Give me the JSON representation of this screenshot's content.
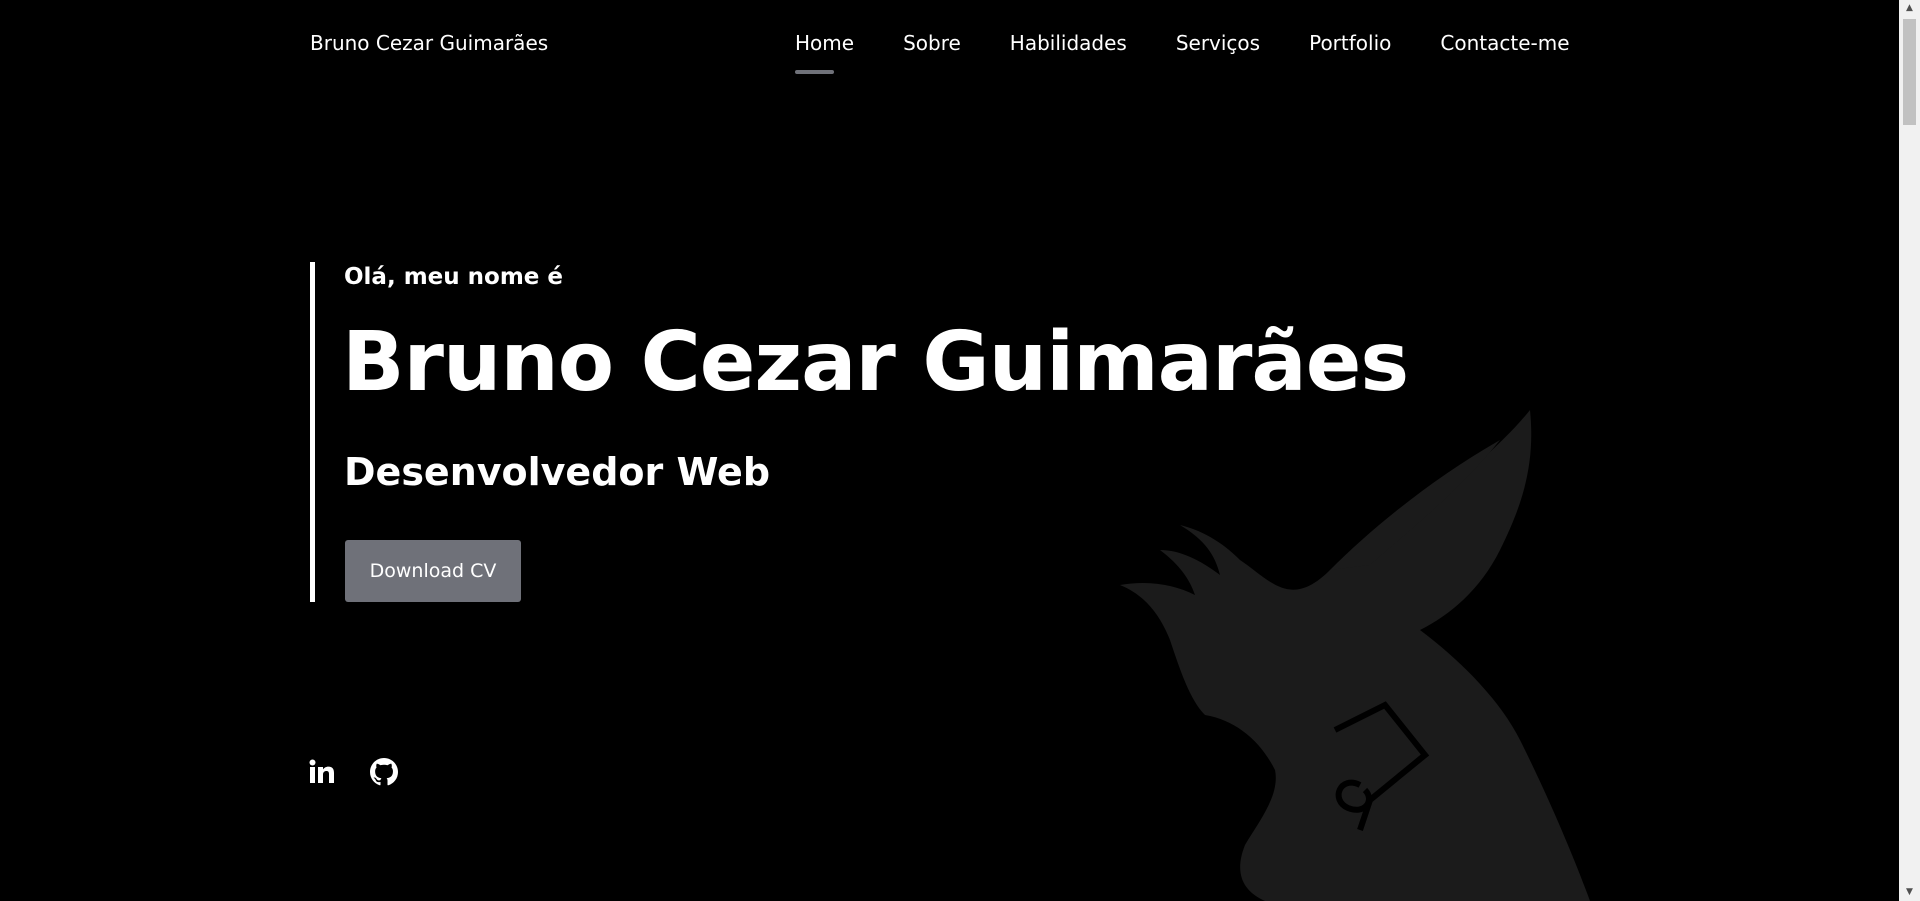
{
  "header": {
    "brand": "Bruno Cezar Guimarães",
    "nav": [
      {
        "label": "Home",
        "active": true
      },
      {
        "label": "Sobre",
        "active": false
      },
      {
        "label": "Habilidades",
        "active": false
      },
      {
        "label": "Serviços",
        "active": false
      },
      {
        "label": "Portfolio",
        "active": false
      },
      {
        "label": "Contacte-me",
        "active": false
      }
    ]
  },
  "hero": {
    "greeting": "Olá, meu nome é",
    "name": "Bruno Cezar Guimarães",
    "role": "Desenvolvedor Web",
    "button_label": "Download CV"
  },
  "social": {
    "icons": [
      "linkedin-icon",
      "github-icon"
    ]
  },
  "colors": {
    "background": "#000000",
    "text": "#ffffff",
    "accent": "#6f7179",
    "bird": "#1b1b1b"
  }
}
